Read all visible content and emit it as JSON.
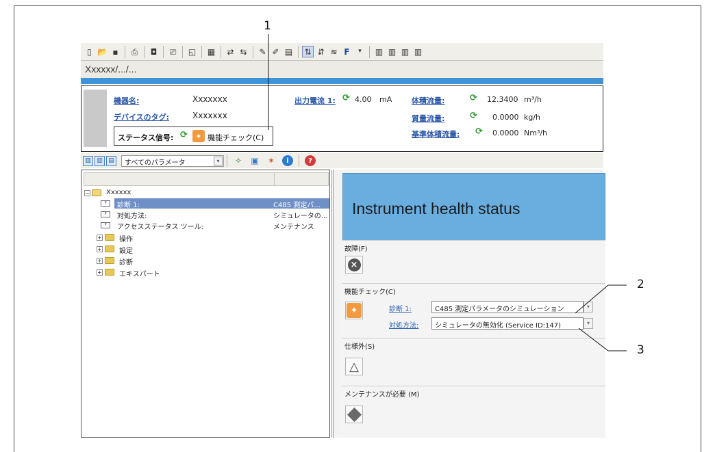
{
  "callouts": {
    "c1": "1",
    "c2": "2",
    "c3": "3"
  },
  "toolbar": {
    "icons": [
      "new-doc-icon",
      "open-folder-icon",
      "save-icon",
      "print-icon",
      "device-icon",
      "print-preview-icon",
      "window-icon",
      "grid-icon",
      "connect-icon",
      "disconnect-icon",
      "edit-icon",
      "pen-icon",
      "calc-icon",
      "online-icon",
      "offline-icon",
      "param-icon",
      "F",
      "dropdown",
      "chart1-icon",
      "chart2-icon",
      "chart3-icon",
      "chart4-icon"
    ],
    "f_label": "F"
  },
  "path": "Xxxxxx/.../...",
  "header": {
    "device_name_label": "機器名:",
    "device_name_value": "Xxxxxxx",
    "device_tag_label": "デバイスのタグ:",
    "device_tag_value": "Xxxxxxx",
    "status_label": "ステータス信号:",
    "status_value": "機能チェック(C)",
    "output_current_label": "出力電流 1:",
    "output_current_value": "4.00",
    "output_current_unit": "mA",
    "volume_flow_label": "体積流量:",
    "volume_flow_value": "12.3400",
    "volume_flow_unit": "m³/h",
    "mass_flow_label": "質量流量:",
    "mass_flow_value": "0.0000",
    "mass_flow_unit": "kg/h",
    "corrected_volume_flow_label": "基準体積流量:",
    "corrected_volume_flow_value": "0.0000",
    "corrected_volume_flow_unit": "Nm³/h"
  },
  "toolbar2": {
    "select_value": "すべてのパラメータ"
  },
  "tree": {
    "root": "Xxxxxx",
    "leaves": [
      {
        "name": "診断 1:",
        "value": "C485 測定パ...",
        "selected": true
      },
      {
        "name": "対処方法:",
        "value": "シミュレータの...",
        "selected": false
      },
      {
        "name": "アクセスステータス ツール:",
        "value": "メンテナンス",
        "selected": false
      }
    ],
    "folders": [
      "操作",
      "設定",
      "診断",
      "エキスパート"
    ]
  },
  "status_panel": {
    "title": "Instrument health status",
    "failure_title": "故障(F)",
    "function_check_title": "機能チェック(C)",
    "diag_label": "診断 1:",
    "diag_value": "C485 測定パラメータのシミュレーション",
    "remedy_label": "対処方法:",
    "remedy_value": "シミュレータの無効化 (Service ID:147)",
    "out_of_spec_title": "仕様外(S)",
    "maintenance_title": "メンテナンスが必要 (M)"
  }
}
